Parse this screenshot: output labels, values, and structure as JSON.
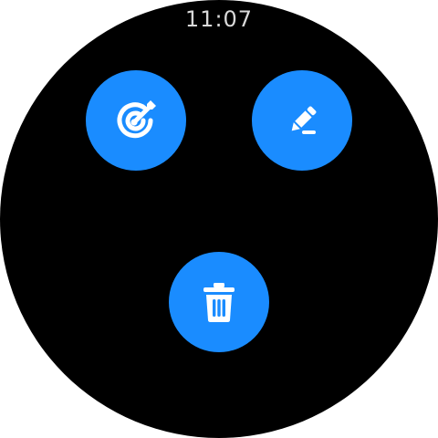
{
  "status_bar": {
    "time": "11:07"
  },
  "actions": [
    {
      "id": "goal",
      "icon": "goal-target-icon"
    },
    {
      "id": "edit",
      "icon": "pencil-icon"
    },
    {
      "id": "delete",
      "icon": "trash-icon"
    }
  ],
  "colors": {
    "background": "#000000",
    "button": "#1a8cff",
    "icon": "#ffffff",
    "time_text": "#d9d9d9"
  }
}
